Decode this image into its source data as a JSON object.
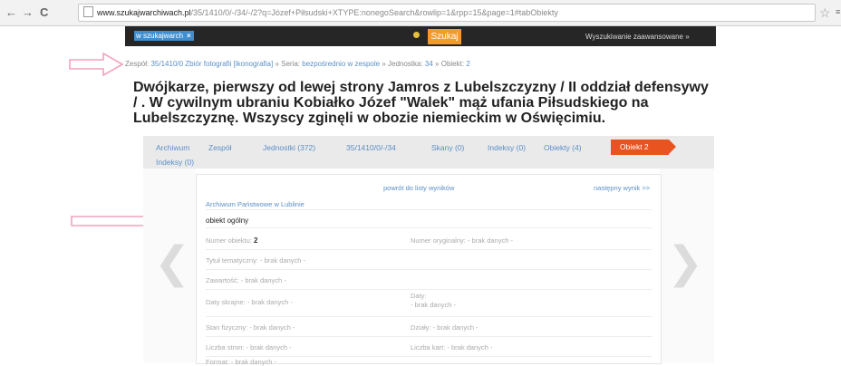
{
  "browser": {
    "back": "←",
    "forward": "→",
    "reload": "C",
    "url_domain": "www.szukajwarchiwach.pl",
    "url_path": "/35/1410/0/-/34/-/2?q=Józef+Piłsudski+XTYPE:nonegoSearch&rowlip=1&rpp=15&page=1#tabObiekty",
    "star": "☆",
    "edge": "≡"
  },
  "topbar": {
    "search_chip": "w szukajwarch",
    "search_chip_close": "×",
    "search_button": "Szukaj",
    "advanced_link": "Wyszukiwanie zaawansowane »"
  },
  "breadcrumb": {
    "label1": "Zespół:",
    "link1": "35/1410/0 Zbiór fotografii [ikonografia]",
    "sep1": " » Seria:",
    "link2": "bezpośrednio w zespole",
    "sep2": " » Jednostka:",
    "link3": "34",
    "sep3": " » Obiekt:",
    "link4": "2"
  },
  "title": "Dwójkarze, pierwszy od lewej strony Jamros z Lubelszczyzny / II oddział defensywy / . W cywilnym ubraniu Kobiałko Józef \"Walek\" mąż ufania Piłsudskiego na Lubelszczyznę. Wszyscy zginęli w obozie niemieckim w Oświęcimiu.",
  "tabs": {
    "archiwum": "Archiwum",
    "zespol": "Zespół",
    "jednostki": "Jednostki (372)",
    "sygnatura": "35/1410/0/-/34",
    "skany": "Skany (0)",
    "indeksy": "Indeksy (0)",
    "obiekty": "Obiekty (4)",
    "obiekt": "Obiekt 2",
    "indeksy2": "Indeksy (0)"
  },
  "card": {
    "back_link": "powrót do listy wyników",
    "next_link": "następny wynik >>",
    "archive_name": "Archiwum Państwowe w Lublinie",
    "record_type": "obiekt ogólny",
    "numer_label": "Numer obiektu:",
    "numer_value": "2",
    "numer_oryg": "Numer oryginalny: - brak danych -",
    "tytul": "Tytuł tematyczny: - brak danych -",
    "zawartosc": "Zawartość: - brak danych -",
    "daty_skrajne": "Daty skrajne: - brak danych -",
    "daty_label": "Daty:",
    "daty_value": "- brak danych -",
    "stan_fizyczny": "Stan fizyczny: - brak danych -",
    "dzialy": "Działy: - brak danych -",
    "liczba_stron": "Liczba stron: - brak danych -",
    "liczba_kart": "Liczba kart: - brak danych -",
    "format": "Format: - brak danych -"
  },
  "nav": {
    "prev": "❮",
    "next": "❯"
  },
  "colors": {
    "accent": "#e8531f",
    "search": "#f29a2e",
    "link": "#5b8fc7",
    "arrow": "#f2a1c0"
  },
  "icons": [
    "page-icon",
    "star-icon",
    "prev-chevron-icon",
    "next-chevron-icon",
    "pointer-arrow-icon"
  ]
}
